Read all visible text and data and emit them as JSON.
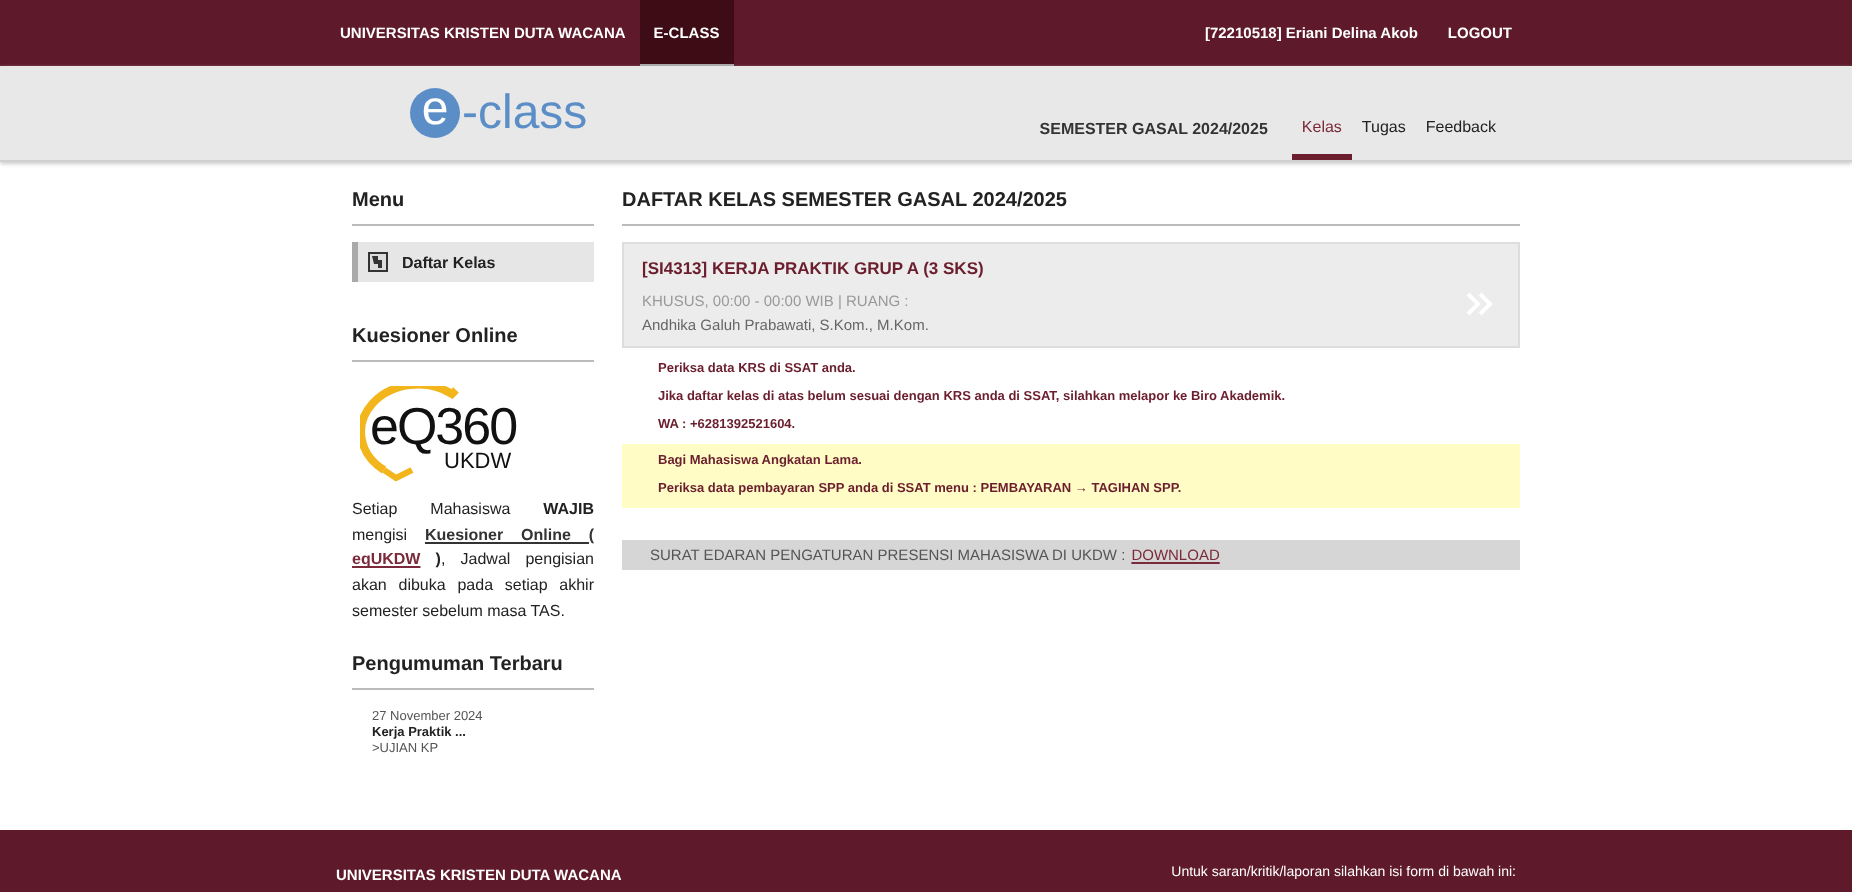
{
  "top_bar": {
    "links": [
      {
        "label": "UNIVERSITAS KRISTEN DUTA WACANA",
        "selected": false
      },
      {
        "label": "E-CLASS",
        "selected": true
      }
    ],
    "user": "[72210518] Eriani Delina Akob",
    "logout": "LOGOUT"
  },
  "header": {
    "logo": {
      "mark": "e",
      "text": "-class"
    },
    "semester": "SEMESTER GASAL 2024/2025",
    "tabs": [
      {
        "label": "Kelas",
        "selected": true
      },
      {
        "label": "Tugas",
        "selected": false
      },
      {
        "label": "Feedback",
        "selected": false
      }
    ]
  },
  "sidebar": {
    "menu_title": "Menu",
    "menu_items": [
      {
        "label": "Daftar Kelas",
        "selected": true
      }
    ],
    "kuesioner_title": "Kuesioner Online",
    "kuesioner_logo": {
      "main": "eQ360",
      "sub": "UKDW"
    },
    "kuesioner_text": {
      "before": "Setiap Mahasiswa **WAJIB** mengisi",
      "link": "Kuesioner Online (",
      "link2": "eqUKDW",
      "after": "**)**, Jadwal pengisian akan dibuka pada setiap akhir semester sebelum masa TAS."
    },
    "announcements_title": "Pengumuman Terbaru",
    "announcements": [
      {
        "date": "27 November 2024",
        "title": "Kerja Praktik ...",
        "summary": ">UJIAN KP"
      }
    ]
  },
  "main": {
    "title": "DAFTAR KELAS SEMESTER GASAL 2024/2025",
    "classes": [
      {
        "name": "[SI4313] KERJA PRAKTIK GRUP A (3 SKS)",
        "schedule": "KHUSUS, 00:00 - 00:00 WIB | RUANG :",
        "lecturer": "Andhika Galuh Prabawati, S.Kom., M.Kom."
      }
    ],
    "notices": [
      {
        "text": "Periksa data KRS di SSAT anda.",
        "highlight": false
      },
      {
        "text": "Jika daftar kelas di atas belum sesuai dengan KRS anda di SSAT, silahkan melapor ke Biro Akademik.",
        "highlight": false
      },
      {
        "text": "WA : +6281392521604.",
        "highlight": false
      },
      {
        "text": "Bagi Mahasiswa Angkatan Lama.",
        "highlight": true
      },
      {
        "text": "Periksa data pembayaran SPP anda di SSAT menu : PEMBAYARAN → TAGIHAN SPP.",
        "highlight": true
      }
    ],
    "circular": {
      "text": "SURAT EDARAN PENGATURAN PRESENSI MAHASISWA DI UKDW :",
      "link": "DOWNLOAD"
    }
  },
  "footer": {
    "name": "UNIVERSITAS KRISTEN DUTA WACANA",
    "note": "Untuk saran/kritik/laporan silahkan isi form di bawah ini:"
  }
}
